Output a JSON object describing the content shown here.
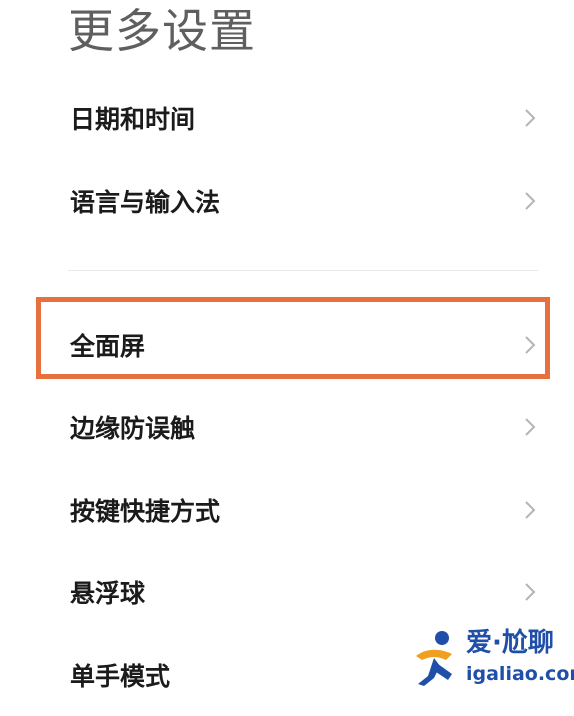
{
  "header": {
    "title": "更多设置"
  },
  "settings": {
    "items": [
      {
        "label": "日期和时间"
      },
      {
        "label": "语言与输入法"
      },
      {
        "label": "全面屏"
      },
      {
        "label": "边缘防误触"
      },
      {
        "label": "按键快捷方式"
      },
      {
        "label": "悬浮球"
      },
      {
        "label": "单手模式"
      }
    ],
    "highlighted_item": "全面屏"
  },
  "watermark": {
    "title": "爱·尬聊",
    "url": "igaliao.com"
  },
  "colors": {
    "highlight_border": "#e8703f",
    "watermark_blue": "#1f4fa8",
    "watermark_orange": "#f0a020",
    "chevron": "#b5b5b5"
  }
}
